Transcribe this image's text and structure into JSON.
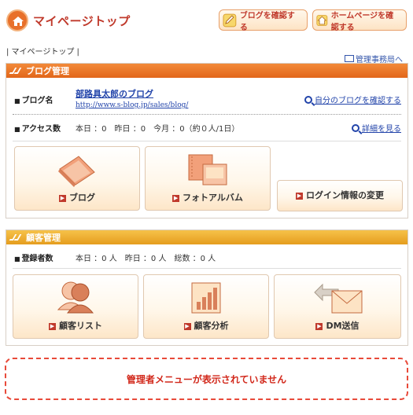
{
  "header": {
    "title": "マイページトップ",
    "check_blog_label": "ブログを確認する",
    "check_homepage_label": "ホームページを確認する"
  },
  "breadcrumb": {
    "text": "| マイページトップ |"
  },
  "admin_link": "管理事務局へ",
  "blog_section": {
    "title": "ブログ管理",
    "blog_name_label": "ブログ名",
    "blog_title": "部路具太郎のブログ",
    "blog_url": "http://www.s-blog.jp/sales/blog/",
    "check_own_blog": "自分のブログを確認する",
    "access_label": "アクセス数",
    "access_text": "本日 ：0　昨日 ：0　今月 ：0（約０人/1日）",
    "details_link": "詳細を見る",
    "tiles": [
      {
        "label": "ブログ"
      },
      {
        "label": "フォトアルバム"
      },
      {
        "label": "ログイン情報の変更"
      }
    ]
  },
  "customer_section": {
    "title": "顧客管理",
    "registered_label": "登録者数",
    "registered_text": "本日 ：0 人　昨日 ：0 人　総数 ：0 人",
    "tiles": [
      {
        "label": "顧客リスト"
      },
      {
        "label": "顧客分析"
      },
      {
        "label": "DM送信"
      }
    ]
  },
  "notice": "管理者メニューが表示されていません",
  "colors": {
    "accent_red": "#c0392b",
    "blog_header_orange": "#e2661a",
    "customer_header_yellow": "#e59d1e",
    "link_blue": "#2244aa",
    "notice_red": "#d2281b"
  }
}
